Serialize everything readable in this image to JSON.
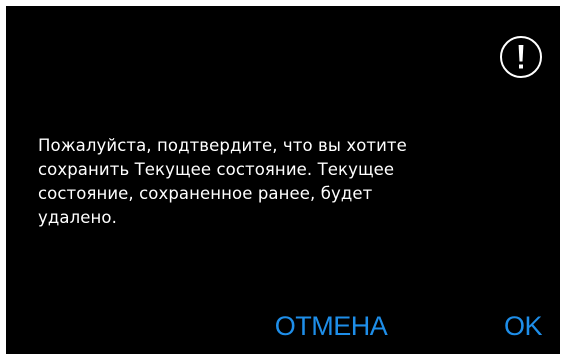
{
  "dialog": {
    "message": "Пожалуйста, подтвердите, что вы хотите\nсохранить Текущее состояние. Текущее\nсостояние, сохраненное ранее, будет\nудалено.",
    "icon": "alert-exclamation-icon",
    "cancel_label": "ОТМЕНА",
    "ok_label": "OK"
  },
  "colors": {
    "background": "#000000",
    "text": "#ffffff",
    "accent": "#1e8ee9"
  }
}
